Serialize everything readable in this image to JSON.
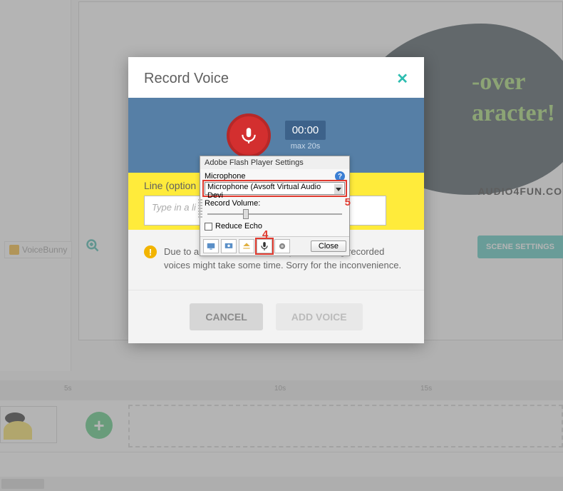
{
  "bg": {
    "bubble_line1": "-over",
    "bubble_line2": "aracter!",
    "audio4fun": "AUDIO4FUN.CO",
    "voicebunny": "VoiceBunny",
    "scene_settings": "SCENE SETTINGS"
  },
  "timeline": {
    "tick5": "5s",
    "tick10": "10s",
    "tick15": "15s"
  },
  "modal": {
    "title": "Record Voice",
    "time": "00:00",
    "max": "max 20s",
    "line_label": "Line (option",
    "line_placeholder": "Type in a li",
    "warning": "Due to a recent Adobe Flash update, adding recorded voices might take some time. Sorry for the inconvenience.",
    "cancel": "CANCEL",
    "add_voice": "ADD VOICE"
  },
  "flash": {
    "title": "Adobe Flash Player Settings",
    "mic_label": "Microphone",
    "mic_value": "Microphone (Avsoft Virtual Audio Devi",
    "rv_label": "Record Volume:",
    "echo_label": "Reduce Echo",
    "close": "Close",
    "ann4": "4",
    "ann5": "5"
  }
}
